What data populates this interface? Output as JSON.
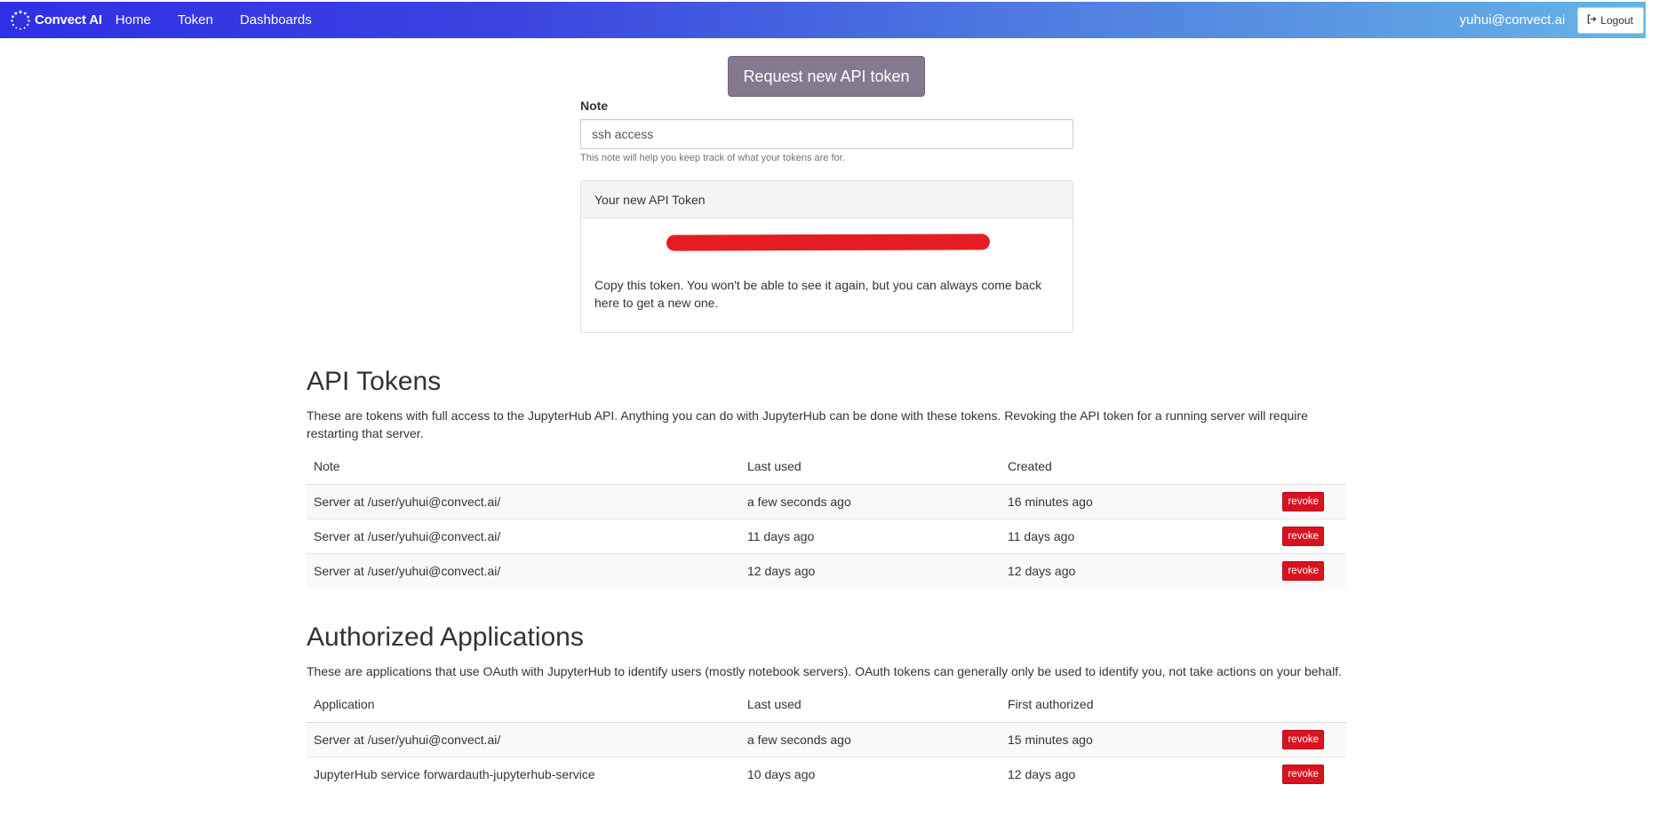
{
  "navbar": {
    "brand": "Convect AI",
    "links": [
      "Home",
      "Token",
      "Dashboards"
    ],
    "user": "yuhui@convect.ai",
    "logout_label": "Logout",
    "logout_icon": "sign-out-icon"
  },
  "request": {
    "button_label": "Request new API token",
    "note_label": "Note",
    "note_value": "ssh access",
    "note_help": "This note will help you keep track of what your tokens are for."
  },
  "new_token": {
    "heading": "Your new API Token",
    "token_redacted": true,
    "instructions": "Copy this token. You won't be able to see it again, but you can always come back here to get a new one."
  },
  "api_tokens": {
    "title": "API Tokens",
    "description": "These are tokens with full access to the JupyterHub API. Anything you can do with JupyterHub can be done with these tokens. Revoking the API token for a running server will require restarting that server.",
    "columns": [
      "Note",
      "Last used",
      "Created"
    ],
    "rows": [
      {
        "note": "Server at /user/yuhui@convect.ai/",
        "last_used": "a few seconds ago",
        "created": "16 minutes ago",
        "action": "revoke"
      },
      {
        "note": "Server at /user/yuhui@convect.ai/",
        "last_used": "11 days ago",
        "created": "11 days ago",
        "action": "revoke"
      },
      {
        "note": "Server at /user/yuhui@convect.ai/",
        "last_used": "12 days ago",
        "created": "12 days ago",
        "action": "revoke"
      }
    ]
  },
  "authorized_apps": {
    "title": "Authorized Applications",
    "description": "These are applications that use OAuth with JupyterHub to identify users (mostly notebook servers). OAuth tokens can generally only be used to identify you, not take actions on your behalf.",
    "columns": [
      "Application",
      "Last used",
      "First authorized"
    ],
    "rows": [
      {
        "app": "Server at /user/yuhui@convect.ai/",
        "last_used": "a few seconds ago",
        "first_authorized": "15 minutes ago",
        "action": "revoke"
      },
      {
        "app": "JupyterHub service forwardauth-jupyterhub-service",
        "last_used": "10 days ago",
        "first_authorized": "12 days ago",
        "action": "revoke"
      }
    ]
  },
  "colors": {
    "nav_gradient_start": "#2f2fe6",
    "nav_gradient_end": "#67b4e6",
    "request_button": "#837a8e",
    "revoke_button": "#d9121f",
    "redaction": "#e51d23"
  }
}
